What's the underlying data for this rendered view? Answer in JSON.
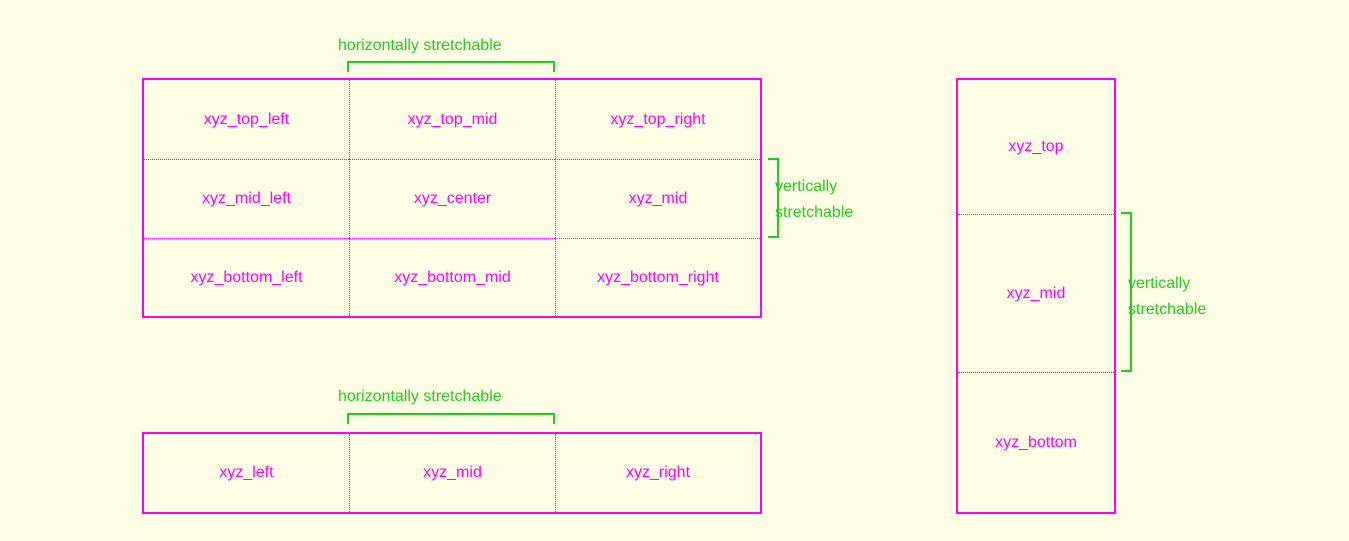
{
  "colors": {
    "box": "#ff00ff",
    "annotation": "#22cc22",
    "background": "#ffffe6"
  },
  "grid9": {
    "top_left": "xyz_top_left",
    "top_mid": "xyz_top_mid",
    "top_right": "xyz_top_right",
    "mid_left": "xyz_mid_left",
    "center": "xyz_center",
    "mid": "xyz_mid",
    "bottom_left": "xyz_bottom_left",
    "bottom_mid": "xyz_bottom_mid",
    "bottom_right": "xyz_bottom_right",
    "h_label": "horizontally stretchable",
    "v_label_line1": "vertically",
    "v_label_line2": "stretchable"
  },
  "row3": {
    "left": "xyz_left",
    "mid": "xyz_mid",
    "right": "xyz_right",
    "h_label": "horizontally stretchable"
  },
  "col3": {
    "top": "xyz_top",
    "mid": "xyz_mid",
    "bottom": "xyz_bottom",
    "v_label_line1": "vertically",
    "v_label_line2": "stretchable"
  }
}
